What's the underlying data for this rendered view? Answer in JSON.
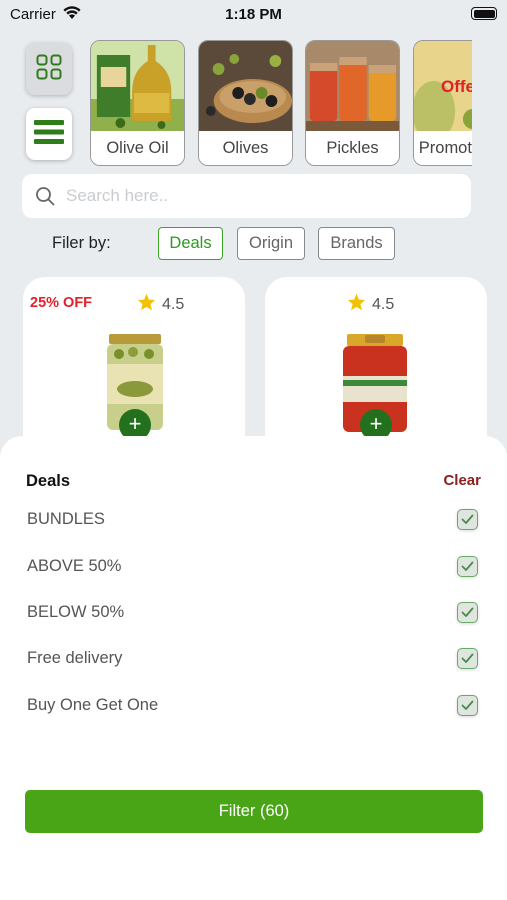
{
  "status": {
    "carrier": "Carrier",
    "time": "1:18 PM"
  },
  "categories": [
    {
      "label": "Olive Oil"
    },
    {
      "label": "Olives"
    },
    {
      "label": "Pickles"
    },
    {
      "label": "Promotions",
      "overlay": "Offe"
    }
  ],
  "search": {
    "placeholder": "Search here.."
  },
  "filter": {
    "label": "Filer by:",
    "chips": [
      "Deals",
      "Origin",
      "Brands"
    ],
    "active": "Deals"
  },
  "products": [
    {
      "discount": "25% OFF",
      "rating": "4.5"
    },
    {
      "discount": "",
      "rating": "4.5"
    }
  ],
  "sheet": {
    "title": "Deals",
    "clear_label": "Clear",
    "options": [
      "BUNDLES",
      "ABOVE 50%",
      "BELOW 50%",
      "Free delivery",
      "Buy One Get One"
    ],
    "button_label": "Filter (60)"
  },
  "colors": {
    "accent": "#49a416",
    "dark_green": "#23711e",
    "discount": "#e0212a",
    "clear": "#8a2020"
  }
}
